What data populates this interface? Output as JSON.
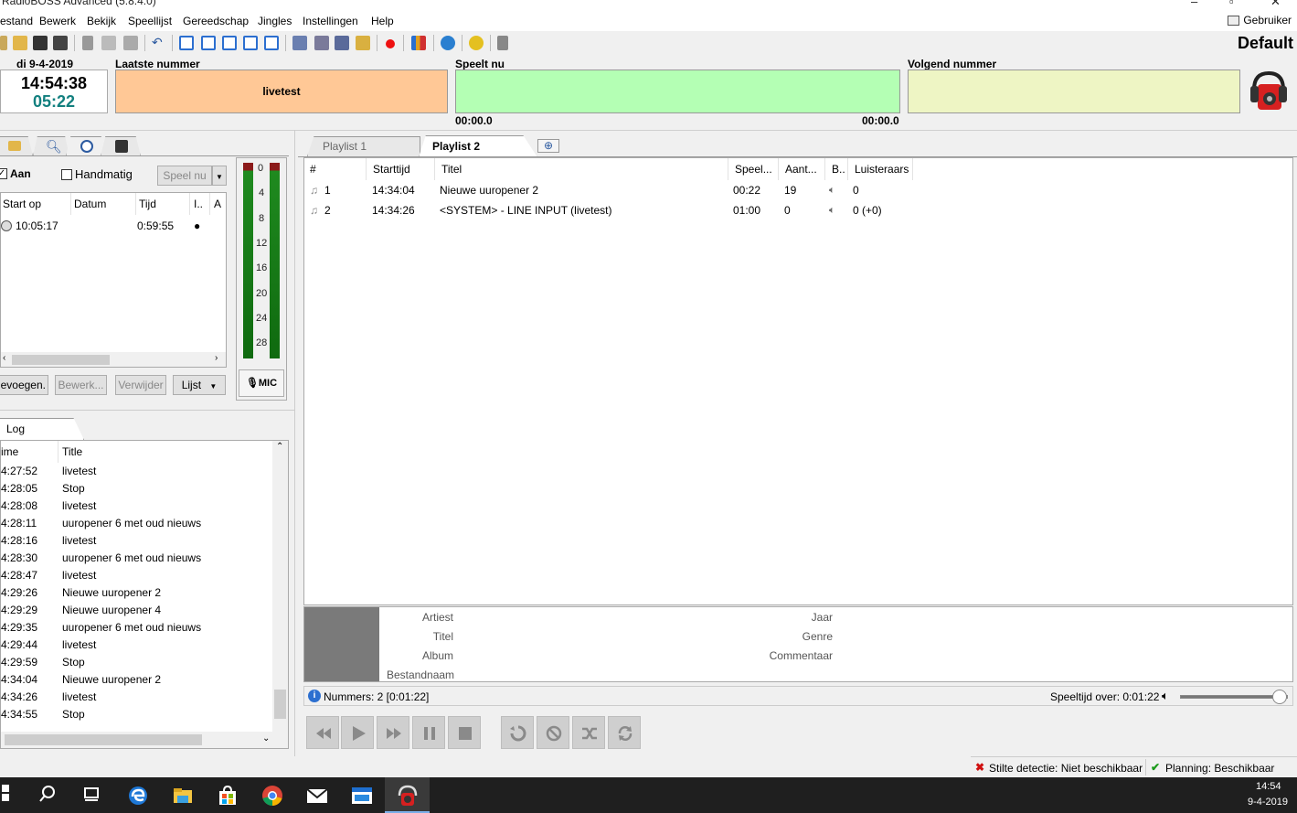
{
  "window": {
    "title": "RadioBOSS Advanced (5.8.4.0)"
  },
  "menu": [
    "estand",
    "Bewerk",
    "Bekijk",
    "Speellijst",
    "Gereedschap",
    "Jingles",
    "Instellingen",
    "Help"
  ],
  "user_label": "Gebruiker",
  "profile": "Default",
  "clock": {
    "date": "di 9-4-2019",
    "time": "14:54:38",
    "countdown": "05:22"
  },
  "now": {
    "last_label": "Laatste nummer",
    "last_value": "livetest",
    "playing_label": "Speelt nu",
    "playing_elapsed": "00:00.0",
    "playing_remaining": "00:00.0",
    "next_label": "Volgend nummer",
    "colors": {
      "last": "#ffc896",
      "playing": "#b4ffb4",
      "next": "#eef5c4"
    }
  },
  "scheduler": {
    "on_label": "Aan",
    "manual_label": "Handmatig",
    "play_now": "Speel nu",
    "columns": [
      "Start op",
      "Datum",
      "Tijd",
      "I..",
      "A"
    ],
    "rows": [
      {
        "start": "10:05:17",
        "date": "",
        "time": "0:59:55",
        "i": "●"
      }
    ],
    "buttons": {
      "add": "evoegen.",
      "edit": "Bewerk...",
      "delete": "Verwijder",
      "list": "Lijst"
    }
  },
  "vu": {
    "ticks": [
      "0",
      "4",
      "8",
      "12",
      "16",
      "20",
      "24",
      "28"
    ],
    "mic": "MIC"
  },
  "log": {
    "tab": "Log",
    "columns": [
      "ime",
      "Title"
    ],
    "rows": [
      {
        "t": "4:27:52",
        "title": "livetest"
      },
      {
        "t": "4:28:05",
        "title": "Stop"
      },
      {
        "t": "4:28:08",
        "title": "livetest"
      },
      {
        "t": "4:28:11",
        "title": "uuropener 6 met oud nieuws"
      },
      {
        "t": "4:28:16",
        "title": "livetest"
      },
      {
        "t": "4:28:30",
        "title": "uuropener 6 met oud nieuws"
      },
      {
        "t": "4:28:47",
        "title": "livetest"
      },
      {
        "t": "4:29:26",
        "title": "Nieuwe uuropener 2"
      },
      {
        "t": "4:29:29",
        "title": "Nieuwe uuropener 4"
      },
      {
        "t": "4:29:35",
        "title": "uuropener 6 met oud nieuws"
      },
      {
        "t": "4:29:44",
        "title": "livetest"
      },
      {
        "t": "4:29:59",
        "title": "Stop"
      },
      {
        "t": "4:34:04",
        "title": "Nieuwe uuropener 2"
      },
      {
        "t": "4:34:26",
        "title": "livetest"
      },
      {
        "t": "4:34:55",
        "title": "Stop"
      }
    ]
  },
  "playlist": {
    "tabs": [
      "Playlist 1",
      "Playlist 2"
    ],
    "active_tab": 1,
    "columns": [
      "#",
      "Starttijd",
      "Titel",
      "Speel...",
      "Aant...",
      "B..",
      "Luisteraars"
    ],
    "rows": [
      {
        "n": "1",
        "start": "14:34:04",
        "title": "Nieuwe uuropener 2",
        "dur": "00:22",
        "count": "19",
        "listeners": "0"
      },
      {
        "n": "2",
        "start": "14:34:26",
        "title": "<SYSTEM> - LINE INPUT (livetest)",
        "dur": "01:00",
        "count": "0",
        "listeners": "0 (+0)"
      }
    ]
  },
  "info": {
    "left_labels": [
      "Artiest",
      "Titel",
      "Album",
      "Bestandnaam"
    ],
    "right_labels": [
      "Jaar",
      "Genre",
      "Commentaar"
    ]
  },
  "status": {
    "tracks": "Nummers: 2 [0:01:22]",
    "remaining": "Speeltijd over: 0:01:22",
    "volume": 1.0
  },
  "bottom_status": {
    "silence": "Stilte detectie: Niet beschikbaar",
    "planning": "Planning: Beschikbaar"
  },
  "taskbar": {
    "time": "14:54",
    "date": "9-4-2019"
  }
}
